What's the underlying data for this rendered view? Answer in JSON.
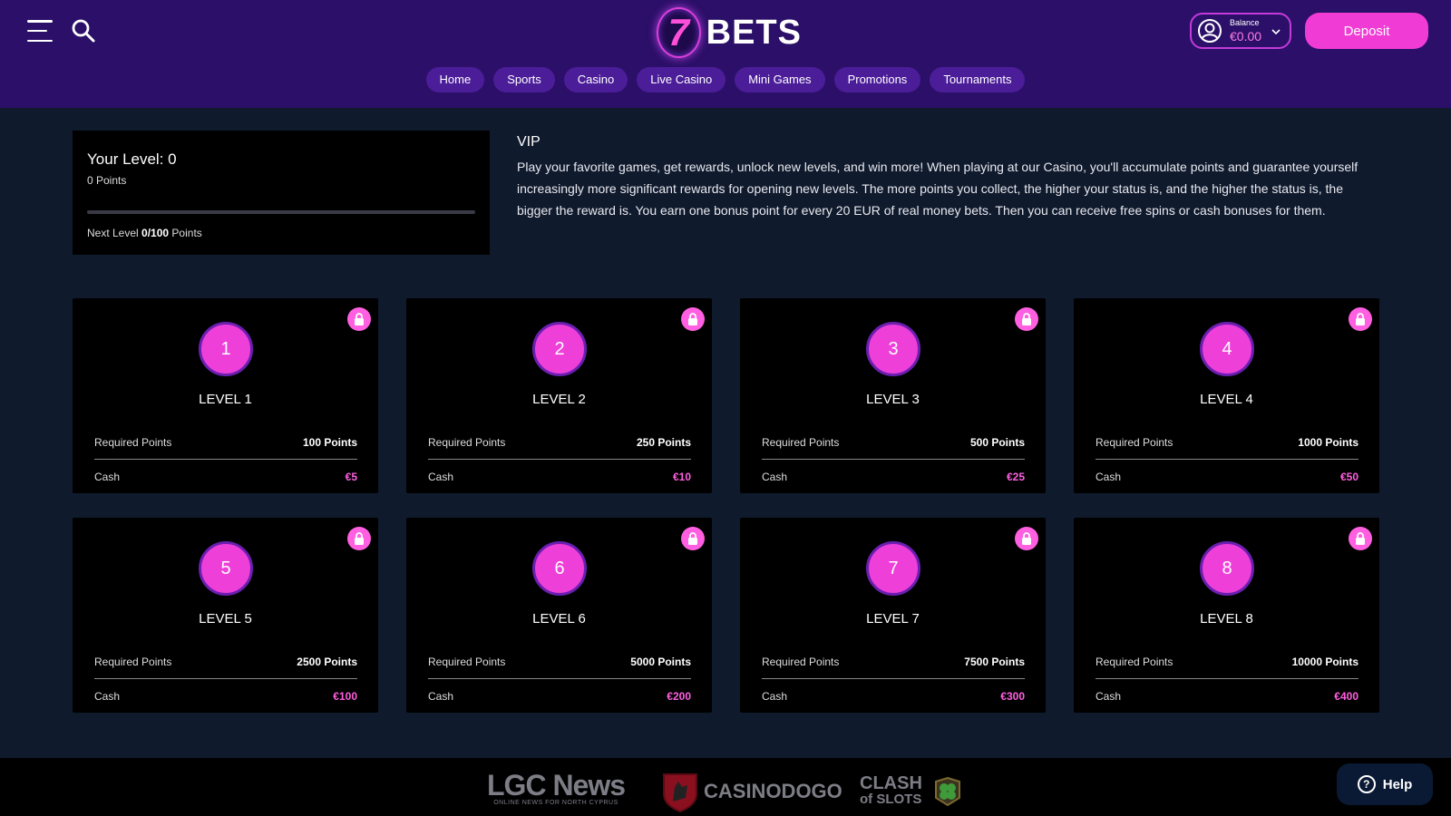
{
  "header": {
    "logo_digit": "7",
    "logo_text": "BETS",
    "balance_label": "Balance",
    "balance_value": "€0.00",
    "deposit_label": "Deposit",
    "nav": [
      "Home",
      "Sports",
      "Casino",
      "Live Casino",
      "Mini Games",
      "Promotions",
      "Tournaments"
    ]
  },
  "status": {
    "level_text": "Your Level: 0",
    "points_text": "0 Points",
    "progress_fraction": 0,
    "next_prefix": "Next Level",
    "next_value": "0/100",
    "next_suffix": "Points"
  },
  "vip": {
    "title": "VIP",
    "body": "Play your favorite games, get rewards, unlock new levels, and win more! When playing at our Casino, you'll accumulate points and guarantee yourself increasingly more significant rewards for opening new levels. The more points you collect, the higher your status is, and the higher the status is, the bigger the reward is. You earn one bonus point for every 20 EUR of real money bets. Then you can receive free spins or cash bonuses for them."
  },
  "levels": {
    "required_label": "Required Points",
    "cash_label": "Cash",
    "items": [
      {
        "num": "1",
        "title": "LEVEL 1",
        "points": "100 Points",
        "cash": "€5"
      },
      {
        "num": "2",
        "title": "LEVEL 2",
        "points": "250 Points",
        "cash": "€10"
      },
      {
        "num": "3",
        "title": "LEVEL 3",
        "points": "500 Points",
        "cash": "€25"
      },
      {
        "num": "4",
        "title": "LEVEL 4",
        "points": "1000 Points",
        "cash": "€50"
      },
      {
        "num": "5",
        "title": "LEVEL 5",
        "points": "2500 Points",
        "cash": "€100"
      },
      {
        "num": "6",
        "title": "LEVEL 6",
        "points": "5000 Points",
        "cash": "€200"
      },
      {
        "num": "7",
        "title": "LEVEL 7",
        "points": "7500 Points",
        "cash": "€300"
      },
      {
        "num": "8",
        "title": "LEVEL 8",
        "points": "10000 Points",
        "cash": "€400"
      }
    ]
  },
  "footer": {
    "lgc_big": "LGC News",
    "lgc_small": "ONLINE NEWS FOR NORTH CYPRUS",
    "dogo": "CASINODOGO",
    "clash_top": "CLASH",
    "clash_bottom": "of SLOTS"
  },
  "help_label": "Help",
  "colors": {
    "header_bg": "#2b0f68",
    "page_bg": "#0f1a2c",
    "accent_pink": "#f03bd4",
    "nav_pill": "#4b1d98"
  }
}
